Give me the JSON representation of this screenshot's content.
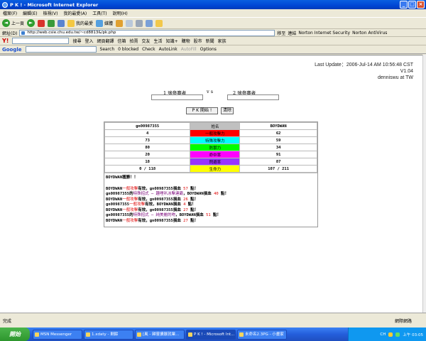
{
  "window": {
    "title": "P K ! - Microsoft Internet Explorer"
  },
  "menu": [
    "檔案(F)",
    "編輯(E)",
    "檢視(V)",
    "我的最愛(A)",
    "工具(T)",
    "說明(H)"
  ],
  "toolbar": {
    "back": "上一頁",
    "favorites": "我的最愛",
    "media": "媒體"
  },
  "address": {
    "label": "網址(D)",
    "url": "http://web.csie.chu.edu.tw/~cd8813&/pk.php",
    "go": "移至",
    "links": "連結",
    "norton_is": "Norton Internet Security",
    "norton_av": "Norton AntiVirus"
  },
  "yahoo": {
    "search": "搜尋",
    "login": "登入",
    "translate": "網頁翻譯",
    "mail": "信箱",
    "auction": "拍賣",
    "friends": "交友",
    "life": "生活",
    "knowledge": "知識+",
    "shopping": "購物",
    "stock": "股市",
    "news": "新聞",
    "home": "家族"
  },
  "google": {
    "brand": "Google",
    "search": "Search",
    "blocked": "0 blocked",
    "check": "Check",
    "autolink": "AutoLink",
    "autofill": "AutoFill",
    "options": "Options"
  },
  "page": {
    "last_update": "Last Update：2006-Jul-14   AM 10:56:48 CST",
    "version": "V1.04",
    "author": "denniswu at TW",
    "player1_label": "1 號參賽者",
    "vs": "v s",
    "player2_label": "2 號參賽者",
    "start_button": "P K 開始 !",
    "clear_button": "清除",
    "table": {
      "left_name": "gn00987355",
      "header": "姓名",
      "right_name": "BOYDWAN",
      "rows": [
        {
          "left": "4",
          "label": "一般攻擊力",
          "right": "62",
          "color": "#ff0000"
        },
        {
          "left": "73",
          "label": "特殊攻擊力",
          "right": "59",
          "color": "#00ffff"
        },
        {
          "left": "80",
          "label": "防禦力",
          "right": "34",
          "color": "#00ff00"
        },
        {
          "left": "20",
          "label": "命中率",
          "right": "91",
          "color": "#ff00ff"
        },
        {
          "left": "18",
          "label": "閃避率",
          "right": "87",
          "color": "#9933ff"
        },
        {
          "left": "0  /  118",
          "label": "生命力",
          "right": "107  /  211",
          "color": "#ffff00"
        }
      ]
    },
    "winner": "BOYDWAN獲勝！！",
    "log": [
      [
        "BOYDWAN",
        "一般攻擊",
        "有效，gn00987355損血 ",
        "57",
        " 點！"
      ],
      [
        "gn00987355的",
        "特殊招式 ─ 趣哩叭冰擊連霸",
        "，BOYDWAN損血 ",
        "40",
        " 點！"
      ],
      [
        "BOYDWAN",
        "一般攻擊",
        "有效，gn00987355損血 ",
        "26",
        " 點！"
      ],
      [
        "gn00987355",
        "一般攻擊",
        "有效，BOYDWAN損血 ",
        "4",
        " 點！"
      ],
      [
        "BOYDWAN",
        "一般攻擊",
        "有效，gn00987355損血 ",
        "27",
        " 點！"
      ],
      [
        "gn00987355的",
        "特殊招式 ─ 純美麗的吻",
        "，BOYDWAN損血 ",
        "51",
        " 點！"
      ],
      [
        "BOYDWAN",
        "一般攻擊",
        "有效，gn00987355損血 ",
        "27",
        " 點！"
      ]
    ]
  },
  "status": {
    "text": "完成",
    "zone": "網際網路"
  },
  "taskbar": {
    "start": "開始",
    "tasks": [
      "MSN Messenger",
      "1.xdaty - 剩餘",
      "[風 - 歸靈擴展就業...",
      "P K ! - Microsoft Int...",
      "未命名2.3PG - 小畫家"
    ],
    "lang": "CH",
    "clock": "上午 03:05"
  }
}
